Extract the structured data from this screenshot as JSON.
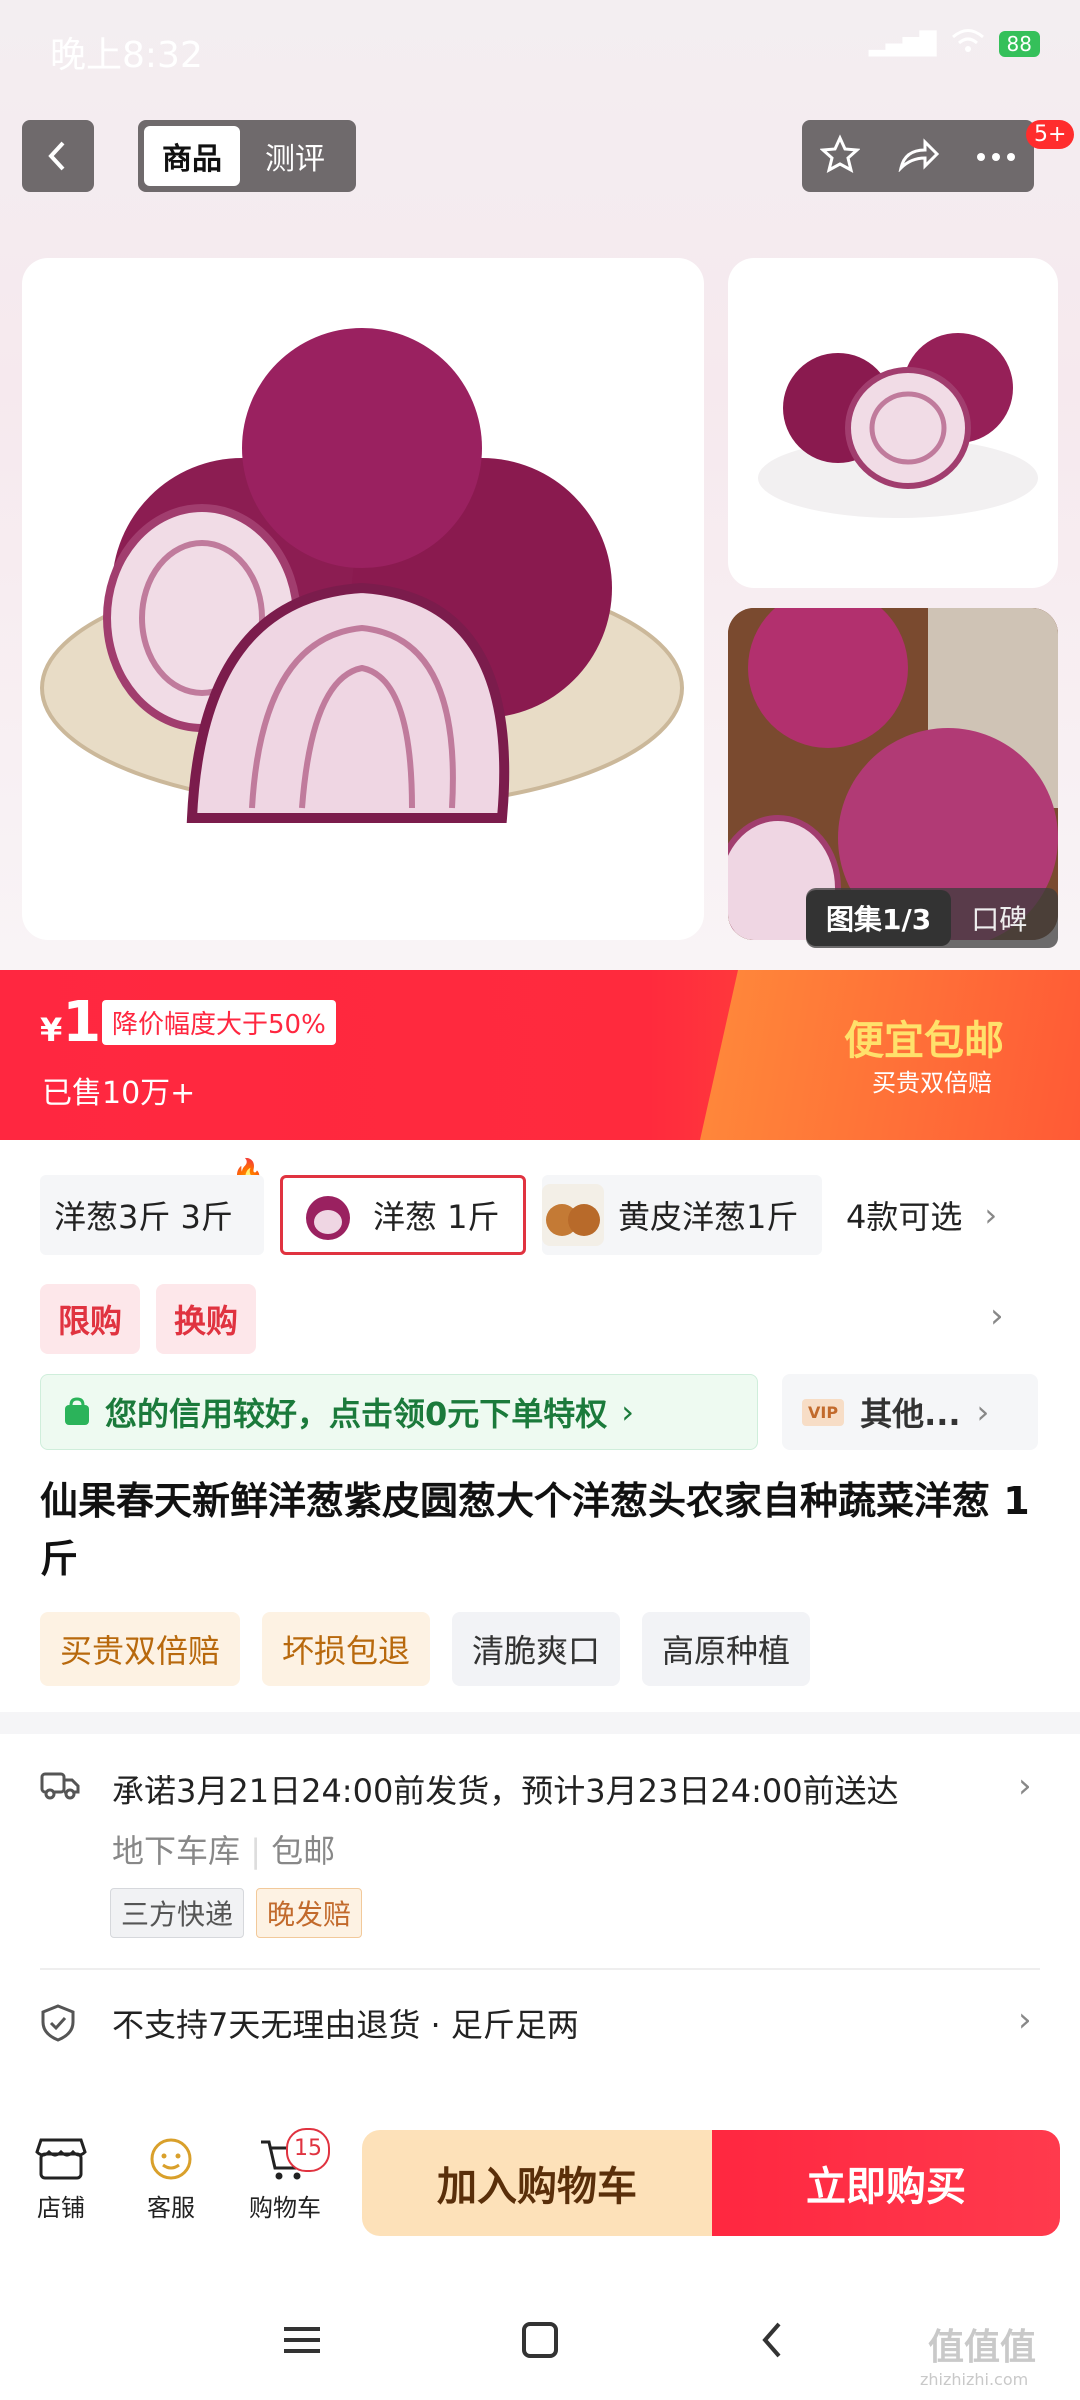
{
  "status_bar": {
    "time": "晚上8:32",
    "battery": "88"
  },
  "header": {
    "tabs": [
      {
        "label": "商品"
      },
      {
        "label": "测评"
      }
    ],
    "badge": "5+"
  },
  "gallery": {
    "counter": "图集1/3",
    "reviews": "口碑"
  },
  "price": {
    "currency": "¥",
    "value": "1",
    "discount": "降价幅度大于50%",
    "sold": "已售10万+",
    "promo_title": "便宜包邮",
    "promo_sub": "买贵双倍赔"
  },
  "variants": {
    "items": [
      {
        "label": "洋葱3斤 3斤"
      },
      {
        "label": "洋葱 1斤"
      },
      {
        "label": "黄皮洋葱1斤"
      }
    ],
    "more": "4款可选"
  },
  "limits": {
    "tag1": "限购",
    "tag2": "换购"
  },
  "credit": {
    "text": "您的信用较好，点击领0元下单特权",
    "other": "其他...",
    "vip": "VIP"
  },
  "product": {
    "title": "仙果春天新鲜洋葱紫皮圆葱大个洋葱头农家自种蔬菜洋葱 1斤",
    "tags": [
      "买贵双倍赔",
      "坏损包退",
      "清脆爽口",
      "高原种植"
    ]
  },
  "shipping": {
    "promise": "承诺3月21日24:00前发货，预计3月23日24:00前送达",
    "from": "地下车库",
    "postage": "包邮",
    "tag1": "三方快递",
    "tag2": "晚发赔",
    "returns": "不支持7天无理由退货",
    "returns_extra": "足斤足两"
  },
  "bottom": {
    "shop": "店铺",
    "service": "客服",
    "cart": "购物车",
    "cart_count": "15",
    "add_to_cart": "加入购物车",
    "buy_now": "立即购买"
  },
  "watermark": {
    "main": "值值值",
    "sub": "zhizhizhi.com"
  },
  "colors": {
    "accent": "#ff2740",
    "promo": "#ffe16b",
    "credit": "#1b7a3b"
  }
}
